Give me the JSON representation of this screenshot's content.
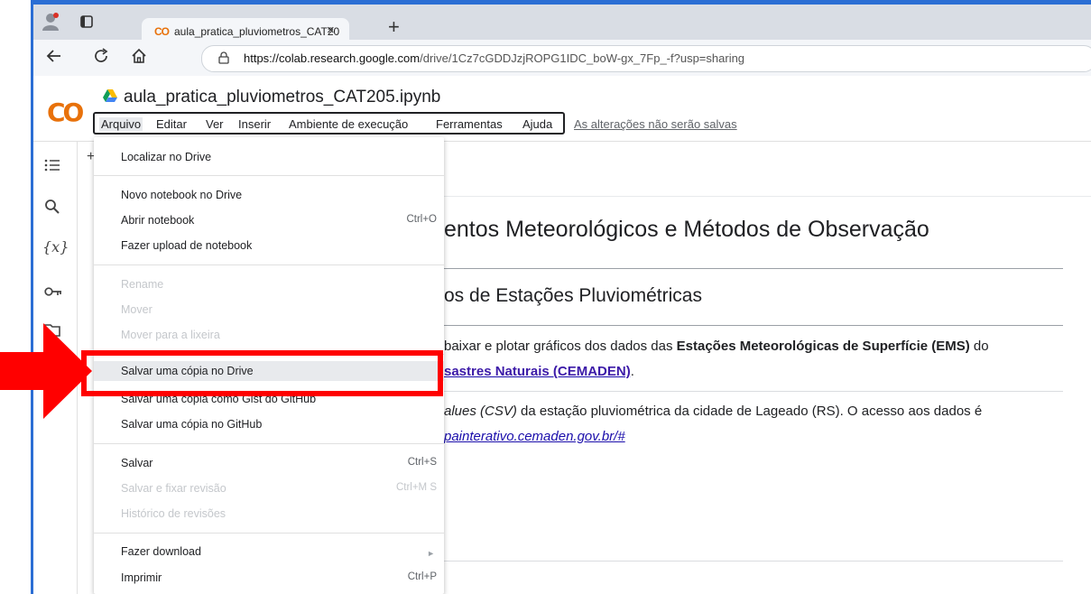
{
  "browser": {
    "tab_title": "aula_pratica_pluviometros_CAT20",
    "tab_logo": "CO",
    "new_tab": "+",
    "close": "×",
    "url_host": "https://colab.research.google.com",
    "url_path": "/drive/1Cz7cGDDJzjROPG1IDC_boW-gx_7Fp_-f?usp=sharing",
    "back_icon": "arrow-left",
    "reload_icon": "reload",
    "home_icon": "home"
  },
  "colab": {
    "logo": "CO",
    "notebook_title": "aula_pratica_pluviometros_CAT205.ipynb",
    "menu": [
      "Arquivo",
      "Editar",
      "Ver",
      "Inserir",
      "Ambiente de execução",
      "Ferramentas",
      "Ajuda"
    ],
    "unsaved_notice": "As alterações não serão salvas"
  },
  "sidebar": {
    "icons": [
      "toc-icon",
      "search-icon",
      "variables-icon",
      "key-icon",
      "folder-icon"
    ],
    "variables_label": "{x}"
  },
  "notebook": {
    "add_button": "+",
    "h1": "entos Meteorológicos e Métodos de Observação",
    "h2": "os de Estações Pluviométricas",
    "p1_a": "baixar e plotar gráficos dos dados das ",
    "p1_b": "Estações Meteorológicas de Superfície (EMS)",
    "p1_c": " do",
    "p1_link": "sastres Naturais (CEMADEN)",
    "p1_end": ".",
    "p2_a": "alues (CSV)",
    "p2_b": " da estação pluviométrica da cidade de Lageado (RS). O acesso aos dados é",
    "p2_link": "painterativo.cemaden.gov.br/#"
  },
  "file_menu": {
    "localizar": "Localizar no Drive",
    "novo": "Novo notebook no Drive",
    "abrir": "Abrir notebook",
    "abrir_shortcut": "Ctrl+O",
    "upload": "Fazer upload de notebook",
    "rename": "Rename",
    "mover": "Mover",
    "lixeira": "Mover para a lixeira",
    "copia_drive": "Salvar uma cópia no Drive",
    "copia_gist": "Salvar uma cópia como Gist do GitHub",
    "copia_github": "Salvar uma cópia no GitHub",
    "salvar": "Salvar",
    "salvar_shortcut": "Ctrl+S",
    "fixar": "Salvar e fixar revisão",
    "fixar_shortcut": "Ctrl+M S",
    "historico": "Histórico de revisões",
    "download": "Fazer download",
    "imprimir": "Imprimir",
    "imprimir_shortcut": "Ctrl+P"
  },
  "annotation": {
    "arrow_color": "#ff0000",
    "box_color": "#ff0000"
  }
}
